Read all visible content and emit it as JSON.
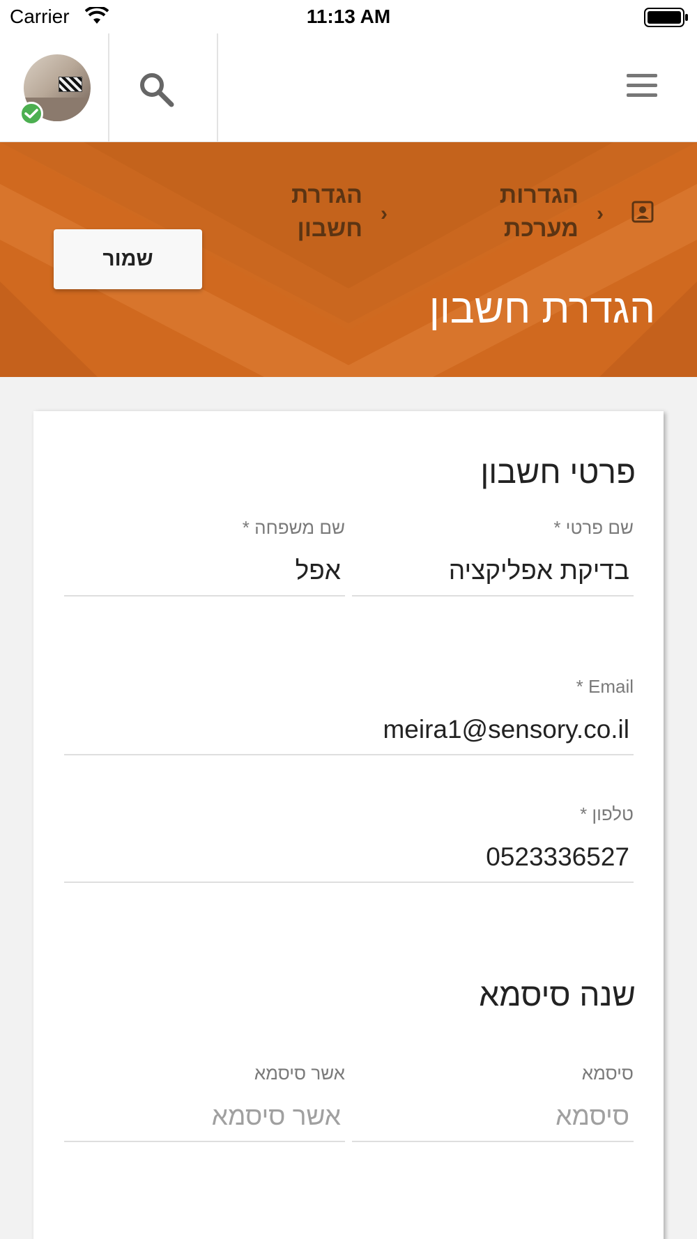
{
  "status_bar": {
    "carrier": "Carrier",
    "time": "11:13 AM"
  },
  "app_bar": {
    "menu_icon": "hamburger-icon",
    "search_icon": "search-icon",
    "avatar_badge_icon": "check-icon"
  },
  "breadcrumb": {
    "home_icon": "account-box-icon",
    "item1": "הגדרות מערכת",
    "item2": "הגדרת חשבון"
  },
  "header": {
    "title": "הגדרת חשבון",
    "save_label": "שמור"
  },
  "account_section": {
    "title": "פרטי חשבון",
    "first_name": {
      "label": "שם פרטי *",
      "value": "בדיקת אפליקציה"
    },
    "last_name": {
      "label": "שם משפחה *",
      "value": "אפל"
    },
    "email": {
      "label": "Email *",
      "value": "meira1@sensory.co.il"
    },
    "phone": {
      "label": "טלפון *",
      "value": "0523336527"
    }
  },
  "password_section": {
    "title": "שנה סיסמא",
    "password": {
      "label": "סיסמא",
      "placeholder": "סיסמא"
    },
    "confirm": {
      "label": "אשר סיסמא",
      "placeholder": "אשר סיסמא"
    }
  },
  "colors": {
    "accent": "#D2691E",
    "breadcrumb_text": "#5B3413",
    "badge": "#4CAF50"
  }
}
